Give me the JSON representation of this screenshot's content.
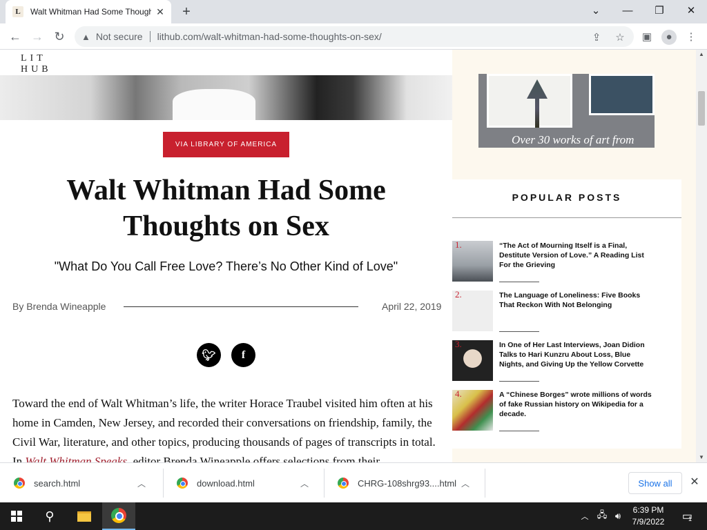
{
  "browser": {
    "tab_title": "Walt Whitman Had Some Thoughts on Sex",
    "tab_favicon": "L",
    "security_label": "Not secure",
    "url": "lithub.com/walt-whitman-had-some-thoughts-on-sex/"
  },
  "site": {
    "logo_line1": "LIT",
    "logo_line2": "HUB"
  },
  "article": {
    "badge": "VIA LIBRARY OF AMERICA",
    "title": "Walt Whitman Had Some Thoughts on Sex",
    "subtitle": "\"What Do You Call Free Love? There’s No Other Kind of Love\"",
    "byline": "By Brenda Wineapple",
    "date": "April 22, 2019",
    "body_part1": "Toward the end of Walt Whitman’s life, the writer Horace Traubel visited him often at his home in Camden, New Jersey, and recorded their conversations on friendship, family, the Civil War, literature, and other topics, producing thousands of pages of transcripts in total. In ",
    "body_link": "Walt Whitman Speaks",
    "body_part2": ", editor Brenda Wineapple offers selections from their"
  },
  "sidebar": {
    "art_caption": "Over 30 works of art from",
    "popular_heading": "POPULAR POSTS",
    "posts": [
      {
        "num": "1.",
        "title": "“The Act of Mourning Itself is a Final, Destitute Version of Love.” A Reading List For the Grieving"
      },
      {
        "num": "2.",
        "title": "The Language of Loneliness: Five Books That Reckon With Not Belonging"
      },
      {
        "num": "3.",
        "title": "In One of Her Last Interviews, Joan Didion Talks to Hari Kunzru About Loss, Blue Nights, and Giving Up the Yellow Corvette"
      },
      {
        "num": "4.",
        "title": "A “Chinese Borges” wrote millions of words of fake Russian history on Wikipedia for a decade."
      }
    ]
  },
  "downloads": {
    "items": [
      "search.html",
      "download.html",
      "CHRG-108shrg93....html"
    ],
    "show_all": "Show all"
  },
  "taskbar": {
    "time": "6:39 PM",
    "date": "7/9/2022",
    "notification_count": "1"
  },
  "colors": {
    "accent_red": "#c8202e",
    "aside_bg": "#fdf8ee"
  }
}
